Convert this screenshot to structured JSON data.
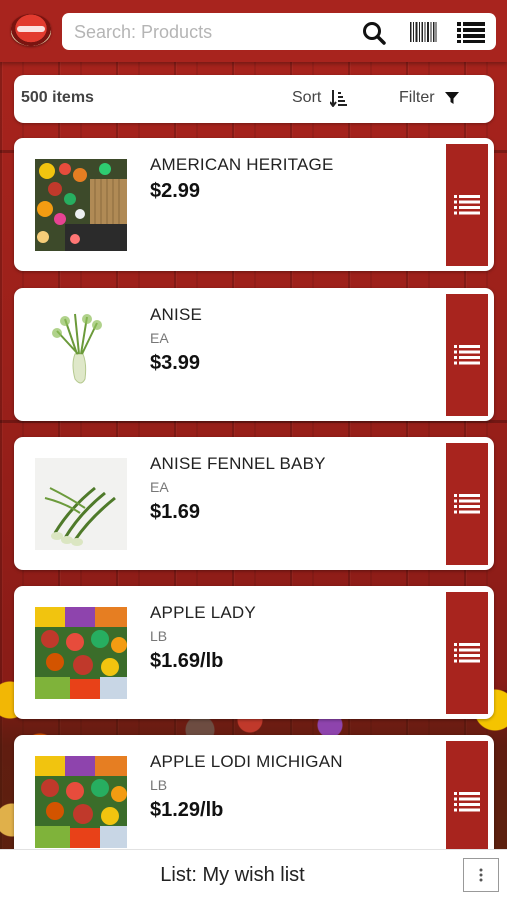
{
  "search": {
    "placeholder": "Search: Products"
  },
  "toolbar": {
    "count_label": "500 items",
    "sort_label": "Sort",
    "filter_label": "Filter"
  },
  "products": [
    {
      "name": "AMERICAN HERITAGE",
      "unit": "",
      "price": "$2.99",
      "image": "garden-flowers"
    },
    {
      "name": "ANISE",
      "unit": "EA",
      "price": "$3.99",
      "image": "fennel-bulb"
    },
    {
      "name": "ANISE FENNEL BABY",
      "unit": "EA",
      "price": "$1.69",
      "image": "baby-fennel"
    },
    {
      "name": "APPLE LADY",
      "unit": "LB",
      "price": "$1.69/lb",
      "image": "mixed-vegetables"
    },
    {
      "name": "APPLE LODI MICHIGAN",
      "unit": "LB",
      "price": "$1.29/lb",
      "image": "mixed-vegetables"
    }
  ],
  "bottom_bar": {
    "list_label": "List: My wish list"
  },
  "colors": {
    "brand_red": "#a8241e",
    "header_red": "#a8241e"
  },
  "icons": [
    "logo",
    "search-icon",
    "barcode-icon",
    "list-icon",
    "sort-icon",
    "filter-icon",
    "add-to-list-icon",
    "more-vertical-icon"
  ]
}
